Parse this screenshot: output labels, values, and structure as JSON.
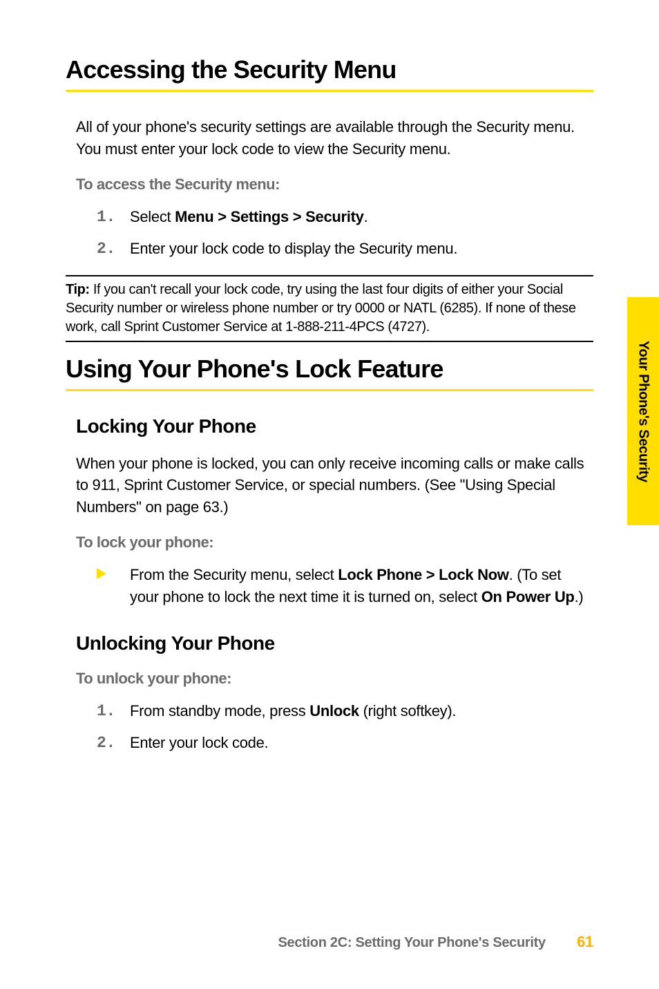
{
  "sideTab": "Your Phone's Security",
  "h1_1": "Accessing the Security Menu",
  "intro1": "All of your phone's security settings are available through the Security menu. You must enter your lock code to view the Security menu.",
  "sub1": "To access the Security menu:",
  "step1_1_pre": "Select ",
  "step1_1_bold": "Menu > Settings > Security",
  "step1_1_post": ".",
  "step1_2": "Enter your lock code to display the Security menu.",
  "tipLabel": "Tip:",
  "tipText": " If you can't recall your lock code, try using the last four digits of either your Social Security number or wireless phone number or try 0000 or NATL (6285). If none of these work, call Sprint Customer Service at 1-888-211-4PCS (4727).",
  "h1_2": "Using Your Phone's Lock Feature",
  "h2_1": "Locking Your Phone",
  "lockBody": "When your phone is locked, you can only receive incoming calls or make calls to 911, Sprint Customer Service, or special numbers. (See \"Using Special Numbers\" on page 63.)",
  "sub2": "To lock your phone:",
  "bullet1_pre": "From the Security menu, select ",
  "bullet1_bold1": "Lock Phone > Lock Now",
  "bullet1_mid": ". (To set your phone to lock the next time it is turned on, select ",
  "bullet1_bold2": "On Power Up",
  "bullet1_post": ".)",
  "h2_2": "Unlocking Your Phone",
  "sub3": "To unlock your phone:",
  "unlock1_pre": "From standby mode, press ",
  "unlock1_bold": "Unlock",
  "unlock1_post": " (right softkey).",
  "unlock2": "Enter your lock code.",
  "footerSection": "Section 2C: Setting Your Phone's Security",
  "pageNum": "61",
  "nums": {
    "n1": "1.",
    "n2": "2."
  }
}
